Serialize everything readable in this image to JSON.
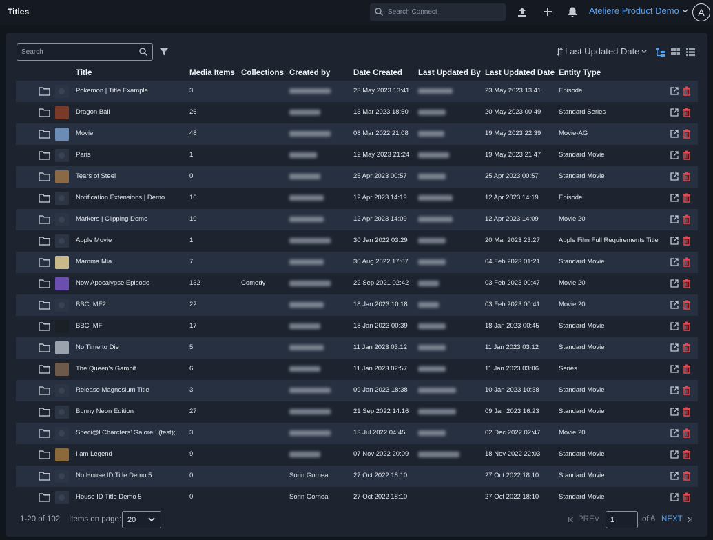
{
  "header": {
    "title": "Titles",
    "search_placeholder": "Search Connect",
    "org_name": "Ateliere Product Demo",
    "avatar_initial": "A"
  },
  "toolbar": {
    "search_placeholder": "Search",
    "sort_label": "Last Updated Date"
  },
  "columns": {
    "title": "Title",
    "media_items": "Media Items",
    "collections": "Collections",
    "created_by": "Created by",
    "date_created": "Date Created",
    "last_updated_by": "Last Updated By",
    "last_updated_date": "Last Updated Date",
    "entity_type": "Entity Type"
  },
  "rows": [
    {
      "title": "Pokemon | Title Example",
      "media": "3",
      "collections": "",
      "created_by": "",
      "date_created": "23 May 2023 13:41",
      "updated_by": "",
      "updated_date": "23 May 2023 13:41",
      "entity": "Episode",
      "thumb": "placeholder"
    },
    {
      "title": "Dragon Ball",
      "media": "26",
      "collections": "",
      "created_by": "",
      "date_created": "13 Mar 2023 18:50",
      "updated_by": "",
      "updated_date": "20 May 2023 00:49",
      "entity": "Standard Series",
      "thumb": "#7a3a2a"
    },
    {
      "title": "Movie",
      "media": "48",
      "collections": "",
      "created_by": "",
      "date_created": "08 Mar 2022 21:08",
      "updated_by": "",
      "updated_date": "19 May 2023 22:39",
      "entity": "Movie-AG",
      "thumb": "#6b8cb5"
    },
    {
      "title": "Paris",
      "media": "1",
      "collections": "",
      "created_by": "",
      "date_created": "12 May 2023 21:24",
      "updated_by": "",
      "updated_date": "19 May 2023 21:47",
      "entity": "Standard Movie",
      "thumb": "placeholder"
    },
    {
      "title": "Tears of Steel",
      "media": "0",
      "collections": "",
      "created_by": "",
      "date_created": "25 Apr 2023 00:57",
      "updated_by": "",
      "updated_date": "25 Apr 2023 00:57",
      "entity": "Standard Movie",
      "thumb": "#8a6a45"
    },
    {
      "title": "Notification Extensions | Demo",
      "media": "16",
      "collections": "",
      "created_by": "",
      "date_created": "12 Apr 2023 14:19",
      "updated_by": "",
      "updated_date": "12 Apr 2023 14:19",
      "entity": "Episode",
      "thumb": "placeholder"
    },
    {
      "title": "Markers | Clipping Demo",
      "media": "10",
      "collections": "",
      "created_by": "",
      "date_created": "12 Apr 2023 14:09",
      "updated_by": "",
      "updated_date": "12 Apr 2023 14:09",
      "entity": "Movie 20",
      "thumb": "placeholder"
    },
    {
      "title": "Apple Movie",
      "media": "1",
      "collections": "",
      "created_by": "",
      "date_created": "30 Jan 2022 03:29",
      "updated_by": "",
      "updated_date": "20 Mar 2023 23:27",
      "entity": "Apple Film Full Requirements Title",
      "thumb": "placeholder"
    },
    {
      "title": "Mamma Mia",
      "media": "7",
      "collections": "",
      "created_by": "",
      "date_created": "30 Aug 2022 17:07",
      "updated_by": "",
      "updated_date": "04 Feb 2023 01:21",
      "entity": "Standard Movie",
      "thumb": "#c9b98a"
    },
    {
      "title": "Now Apocalypse Episode",
      "media": "132",
      "collections": "Comedy",
      "created_by": "",
      "date_created": "22 Sep 2021 02:42",
      "updated_by": "",
      "updated_date": "03 Feb 2023 00:47",
      "entity": "Movie 20",
      "thumb": "#6a4fb0"
    },
    {
      "title": "BBC IMF2",
      "media": "22",
      "collections": "",
      "created_by": "",
      "date_created": "18 Jan 2023 10:18",
      "updated_by": "",
      "updated_date": "03 Feb 2023 00:41",
      "entity": "Movie 20",
      "thumb": "placeholder"
    },
    {
      "title": "BBC IMF",
      "media": "17",
      "collections": "",
      "created_by": "",
      "date_created": "18 Jan 2023 00:39",
      "updated_by": "",
      "updated_date": "18 Jan 2023 00:45",
      "entity": "Standard Movie",
      "thumb": "#1b1f26"
    },
    {
      "title": "No Time to Die",
      "media": "5",
      "collections": "",
      "created_by": "",
      "date_created": "11 Jan 2023 03:12",
      "updated_by": "",
      "updated_date": "11 Jan 2023 03:12",
      "entity": "Standard Movie",
      "thumb": "#9aa3ad"
    },
    {
      "title": "The Queen's Gambit",
      "media": "6",
      "collections": "",
      "created_by": "",
      "date_created": "11 Jan 2023 02:57",
      "updated_by": "",
      "updated_date": "11 Jan 2023 03:06",
      "entity": "Series",
      "thumb": "#6e5a4a"
    },
    {
      "title": "Release Magnesium Title",
      "media": "3",
      "collections": "",
      "created_by": "",
      "date_created": "09 Jan 2023 18:38",
      "updated_by": "",
      "updated_date": "10 Jan 2023 10:38",
      "entity": "Standard Movie",
      "thumb": "placeholder"
    },
    {
      "title": "Bunny Neon Edition",
      "media": "27",
      "collections": "",
      "created_by": "",
      "date_created": "21 Sep 2022 14:16",
      "updated_by": "",
      "updated_date": "09 Jan 2023 16:23",
      "entity": "Standard Movie",
      "thumb": "placeholder"
    },
    {
      "title": "Speci@l Charcters' Galore!! (test); &...",
      "media": "3",
      "collections": "",
      "created_by": "",
      "date_created": "13 Jul 2022 04:45",
      "updated_by": "",
      "updated_date": "02 Dec 2022 02:47",
      "entity": "Movie 20",
      "thumb": "placeholder"
    },
    {
      "title": "I am Legend",
      "media": "9",
      "collections": "",
      "created_by": "",
      "date_created": "07 Nov 2022 20:09",
      "updated_by": "",
      "updated_date": "18 Nov 2022 22:03",
      "entity": "Standard Movie",
      "thumb": "#8a6a3a"
    },
    {
      "title": "No House ID Title Demo 5",
      "media": "0",
      "collections": "",
      "created_by": "Sorin Gornea",
      "date_created": "27 Oct 2022 18:10",
      "updated_by": "",
      "updated_date": "27 Oct 2022 18:10",
      "entity": "Standard Movie",
      "thumb": "placeholder"
    },
    {
      "title": "House ID Title Demo 5",
      "media": "0",
      "collections": "",
      "created_by": "Sorin Gornea",
      "date_created": "27 Oct 2022 18:10",
      "updated_by": "",
      "updated_date": "27 Oct 2022 18:10",
      "entity": "Standard Movie",
      "thumb": "placeholder"
    }
  ],
  "pagination": {
    "range": "1-20 of 102",
    "items_label": "Items on page:",
    "items_per_page": "20",
    "prev": "PREV",
    "page": "1",
    "of_pages": "of 6",
    "next": "NEXT"
  },
  "colors": {
    "accent": "#4fa3ff",
    "delete": "#e5484d",
    "background": "#11151c",
    "panel": "#1d2430",
    "row_alt": "#273040"
  }
}
